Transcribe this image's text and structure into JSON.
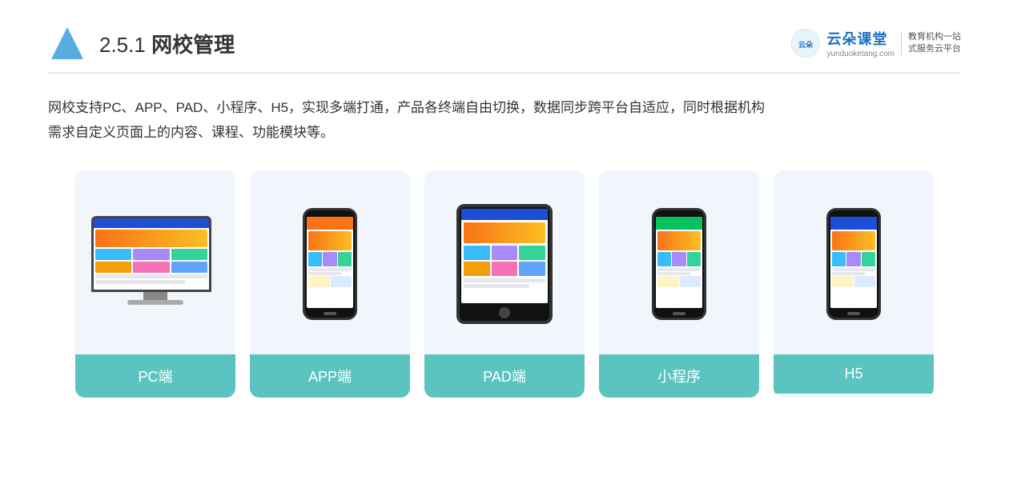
{
  "header": {
    "title_prefix": "2.5.1 ",
    "title_bold": "网校管理",
    "brand": {
      "name": "云朵课堂",
      "url": "yunduoketang.com",
      "slogan_line1": "教育机构一站",
      "slogan_line2": "式服务云平台"
    }
  },
  "description": {
    "line1": "网校支持PC、APP、PAD、小程序、H5，实现多端打通，产品各终端自由切换，数据同步跨平台自适应，同时根据机构",
    "line2": "需求自定义页面上的内容、课程、功能模块等。"
  },
  "cards": [
    {
      "id": "pc",
      "label": "PC端",
      "device": "pc"
    },
    {
      "id": "app",
      "label": "APP端",
      "device": "phone"
    },
    {
      "id": "pad",
      "label": "PAD端",
      "device": "tablet"
    },
    {
      "id": "miniprogram",
      "label": "小程序",
      "device": "phone"
    },
    {
      "id": "h5",
      "label": "H5",
      "device": "phone"
    }
  ]
}
